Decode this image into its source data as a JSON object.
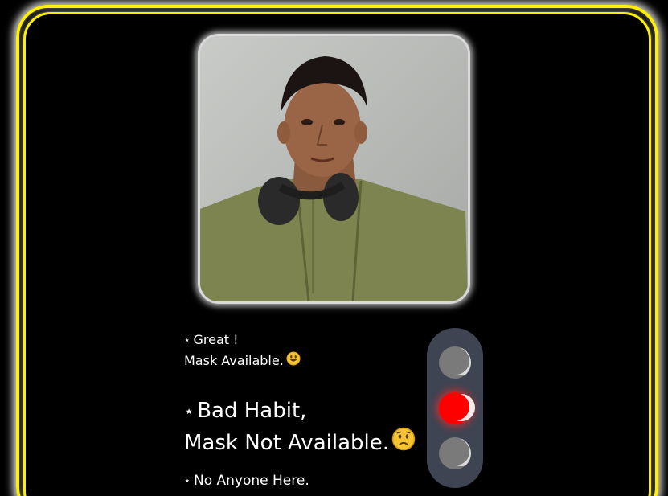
{
  "photo": {
    "alt": "person with headphones"
  },
  "status": {
    "great": {
      "star": "⋆",
      "line1": "Great !",
      "line2": "Mask Available.",
      "emoji": "smiling-face"
    },
    "bad": {
      "star": "⋆",
      "line1": "Bad Habit,",
      "line2": "Mask Not Available.",
      "emoji": "worried-face"
    },
    "none": {
      "star": "⋆",
      "line1": "No Anyone Here."
    }
  },
  "traffic_light": {
    "lamps": [
      "off",
      "red-on",
      "off"
    ],
    "active_color": "#ff0000"
  },
  "colors": {
    "frame": "#ffef00",
    "background": "#000000"
  }
}
